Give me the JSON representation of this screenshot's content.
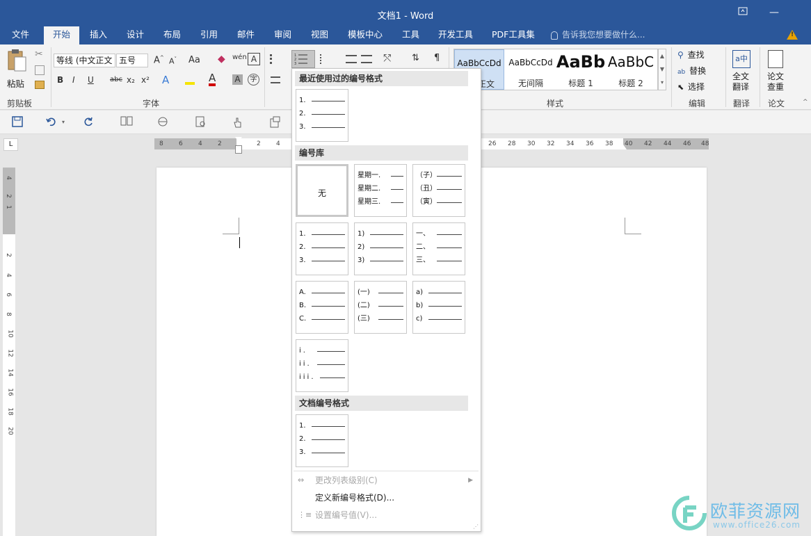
{
  "window": {
    "title": "文档1 - Word"
  },
  "tabs": [
    "文件",
    "开始",
    "插入",
    "设计",
    "布局",
    "引用",
    "邮件",
    "审阅",
    "视图",
    "模板中心",
    "工具",
    "开发工具",
    "PDF工具集"
  ],
  "active_tab": "开始",
  "tell_me": {
    "placeholder": "告诉我您想要做什么..."
  },
  "ribbon": {
    "clipboard": {
      "label": "剪贴板",
      "paste": "粘贴"
    },
    "font": {
      "label": "字体",
      "font_name": "等线 (中文正文",
      "font_size": "五号",
      "change_case": "Aa",
      "phonetic": "wén",
      "bold": "B",
      "italic": "I",
      "underline": "U",
      "strike": "abc",
      "subscript": "x₂",
      "superscript": "x²"
    },
    "styles": {
      "label": "样式",
      "items": [
        {
          "sample": "AaBbCcDd",
          "name": "正文"
        },
        {
          "sample": "AaBbCcDd",
          "name": "无间隔"
        },
        {
          "sample": "AaBb",
          "name": "标题 1"
        },
        {
          "sample": "AaBbC",
          "name": "标题 2"
        }
      ]
    },
    "editing": {
      "label": "编辑",
      "find": "查找",
      "replace": "替换",
      "select": "选择"
    },
    "translate": {
      "label": "翻译",
      "button": "全文翻译"
    },
    "paper": {
      "label": "论文",
      "button": "论文查重"
    }
  },
  "ruler": {
    "h_left": [
      "8",
      "6",
      "4",
      "2"
    ],
    "h_right": [
      "2",
      "4",
      "26",
      "28",
      "30",
      "32",
      "34",
      "36",
      "38",
      "40",
      "42",
      "44",
      "46",
      "48"
    ],
    "v": [
      "4",
      "2",
      "1",
      "2",
      "4",
      "6",
      "8",
      "10",
      "12",
      "14",
      "16",
      "18",
      "20"
    ]
  },
  "numbering_menu": {
    "recent_header": "最近使用过的编号格式",
    "library_header": "编号库",
    "document_header": "文档编号格式",
    "none_label": "无",
    "recent": [
      [
        "1.",
        "2.",
        "3."
      ]
    ],
    "library": [
      [
        "星期一.",
        "星期二.",
        "星期三."
      ],
      [
        "（子）",
        "（丑）",
        "（寅）"
      ],
      [
        "1.",
        "2.",
        "3."
      ],
      [
        "1)",
        "2)",
        "3)"
      ],
      [
        "一、",
        "二、",
        "三、"
      ],
      [
        "A.",
        "B.",
        "C."
      ],
      [
        "(一)",
        "(二)",
        "(三)"
      ],
      [
        "a)",
        "b)",
        "c)"
      ],
      [
        "i.",
        "ii.",
        "iii."
      ]
    ],
    "document": [
      [
        "1.",
        "2.",
        "3."
      ]
    ],
    "commands": [
      {
        "label": "更改列表级别(C)",
        "disabled": true,
        "submenu": true
      },
      {
        "label": "定义新编号格式(D)...",
        "disabled": false,
        "submenu": false
      },
      {
        "label": "设置编号值(V)...",
        "disabled": true,
        "submenu": false
      }
    ]
  },
  "watermark": {
    "brand": "欧菲资源网",
    "url": "www.office26.com"
  },
  "colors": {
    "accent": "#2b579a",
    "ribbon_bg": "#f3f3f3",
    "warning": "#e8a200"
  }
}
